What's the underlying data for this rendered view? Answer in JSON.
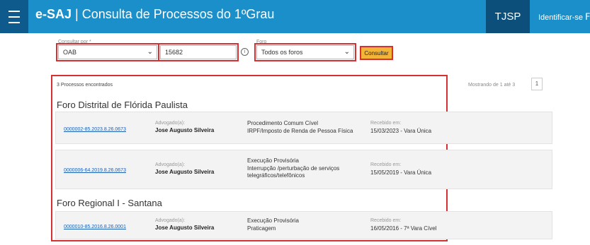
{
  "header": {
    "app_bold": "e-SAJ",
    "app_rest": " | Consulta de Processos do 1ºGrau",
    "tjsp": "TJSP",
    "identificar": "Identificar-se"
  },
  "search": {
    "consultar_por_label": "Consultar por *",
    "consultar_por_value": "OAB",
    "oab_value": "15682",
    "foro_label": "Foro",
    "foro_value": "Todos os foros",
    "consultar_button": "Consultar"
  },
  "results": {
    "count": "3 Processos encontrados",
    "mostrando": "Mostrando de 1 até 3",
    "page": "1",
    "groups": [
      {
        "title": "Foro Distrital de Flórida Paulista",
        "items": [
          {
            "numero": "0000002-85.2023.8.26.0673",
            "adv_label": "Advogado(a):",
            "advogado": "Jose Augusto Silveira",
            "classe": "Procedimento Comum Cível",
            "assunto": "IRPF/Imposto de Renda de Pessoa Física",
            "rec_label": "Recebido em:",
            "recebido": "15/03/2023 - Vara Única"
          },
          {
            "numero": "0000006-64.2019.8.26.0673",
            "adv_label": "Advogado(a):",
            "advogado": "Jose Augusto Silveira",
            "classe": "Execução Provisória",
            "assunto": "Interrupção /perturbação de serviços telegráficos/telefônicos",
            "rec_label": "Recebido em:",
            "recebido": "15/05/2019 - Vara Única"
          }
        ]
      },
      {
        "title": "Foro Regional I - Santana",
        "items": [
          {
            "numero": "0000010-85.2016.8.26.0001",
            "adv_label": "Advogado(a):",
            "advogado": "Jose Augusto Silveira",
            "classe": "Execução Provisória",
            "assunto": "Praticagem",
            "rec_label": "Recebido em:",
            "recebido": "16/05/2016 - 7ª Vara Cível"
          }
        ]
      }
    ]
  }
}
